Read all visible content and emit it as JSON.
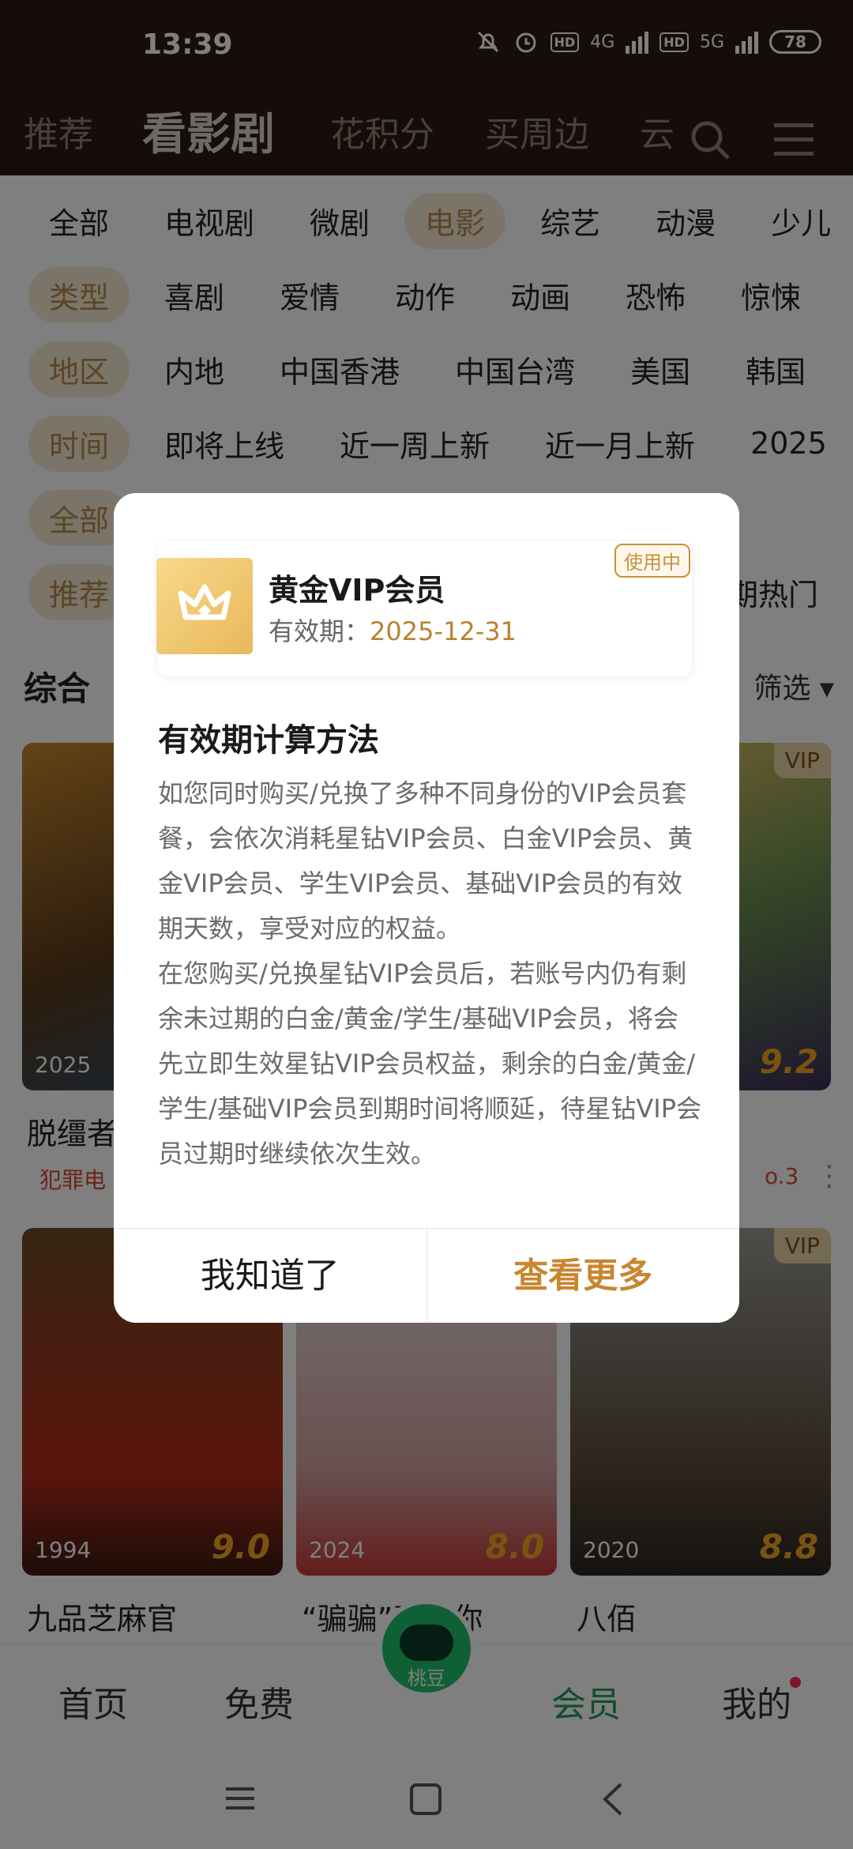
{
  "status": {
    "time": "13:39",
    "battery": "78",
    "net1": "4G",
    "net2": "5G",
    "hd": "HD"
  },
  "top_nav": [
    "推荐",
    "看影剧",
    "花积分",
    "买周边",
    "云"
  ],
  "filters": {
    "channels": [
      "全部",
      "电视剧",
      "微剧",
      "电影",
      "综艺",
      "动漫",
      "少儿"
    ],
    "genres": [
      "类型",
      "喜剧",
      "爱情",
      "动作",
      "动画",
      "恐怖",
      "惊悚"
    ],
    "regions": [
      "地区",
      "内地",
      "中国香港",
      "中国台湾",
      "美国",
      "韩国"
    ],
    "times": [
      "时间",
      "即将上线",
      "近一周上新",
      "近一月上新",
      "2025"
    ],
    "row5_label": "全部",
    "row6_label": "推荐",
    "row6_right": "近期热门"
  },
  "section": {
    "title": "综合",
    "filter": "筛选"
  },
  "cards": [
    {
      "title": "脱缰者",
      "year": "2025",
      "tag": "犯罪电"
    },
    {
      "title": "",
      "score": "9.2",
      "vip": "VIP",
      "tag": "o.3"
    },
    {
      "title": "九品芝麻官",
      "year": "1994",
      "score": "9.0"
    },
    {
      "title": "“骗骗”喜欢你",
      "year": "2024",
      "score": "8.0"
    },
    {
      "title": "八佰",
      "year": "2020",
      "score": "8.8",
      "vip": "VIP"
    }
  ],
  "bottom_nav": {
    "home": "首页",
    "free": "免费",
    "logo": "桃豆",
    "member": "会员",
    "mine": "我的"
  },
  "dialog": {
    "vip_name": "黄金VIP会员",
    "expiry_label": "有效期：",
    "expiry_date": "2025-12-31",
    "status_badge": "使用中",
    "title": "有效期计算方法",
    "para1": "如您同时购买/兑换了多种不同身份的VIP会员套餐，会依次消耗星钻VIP会员、白金VIP会员、黄金VIP会员、学生VIP会员、基础VIP会员的有效期天数，享受对应的权益。",
    "para2": "在您购买/兑换星钻VIP会员后，若账号内仍有剩余未过期的白金/黄金/学生/基础VIP会员，将会先立即生效星钻VIP会员权益，剩余的白金/黄金/学生/基础VIP会员到期时间将顺延，待星钻VIP会员过期时继续依次生效。",
    "btn_ok": "我知道了",
    "btn_more": "查看更多"
  },
  "colors": {
    "accent_gold": "#c8862e",
    "brand_green": "#1ec26a",
    "header_bg": "#2a1a12"
  }
}
